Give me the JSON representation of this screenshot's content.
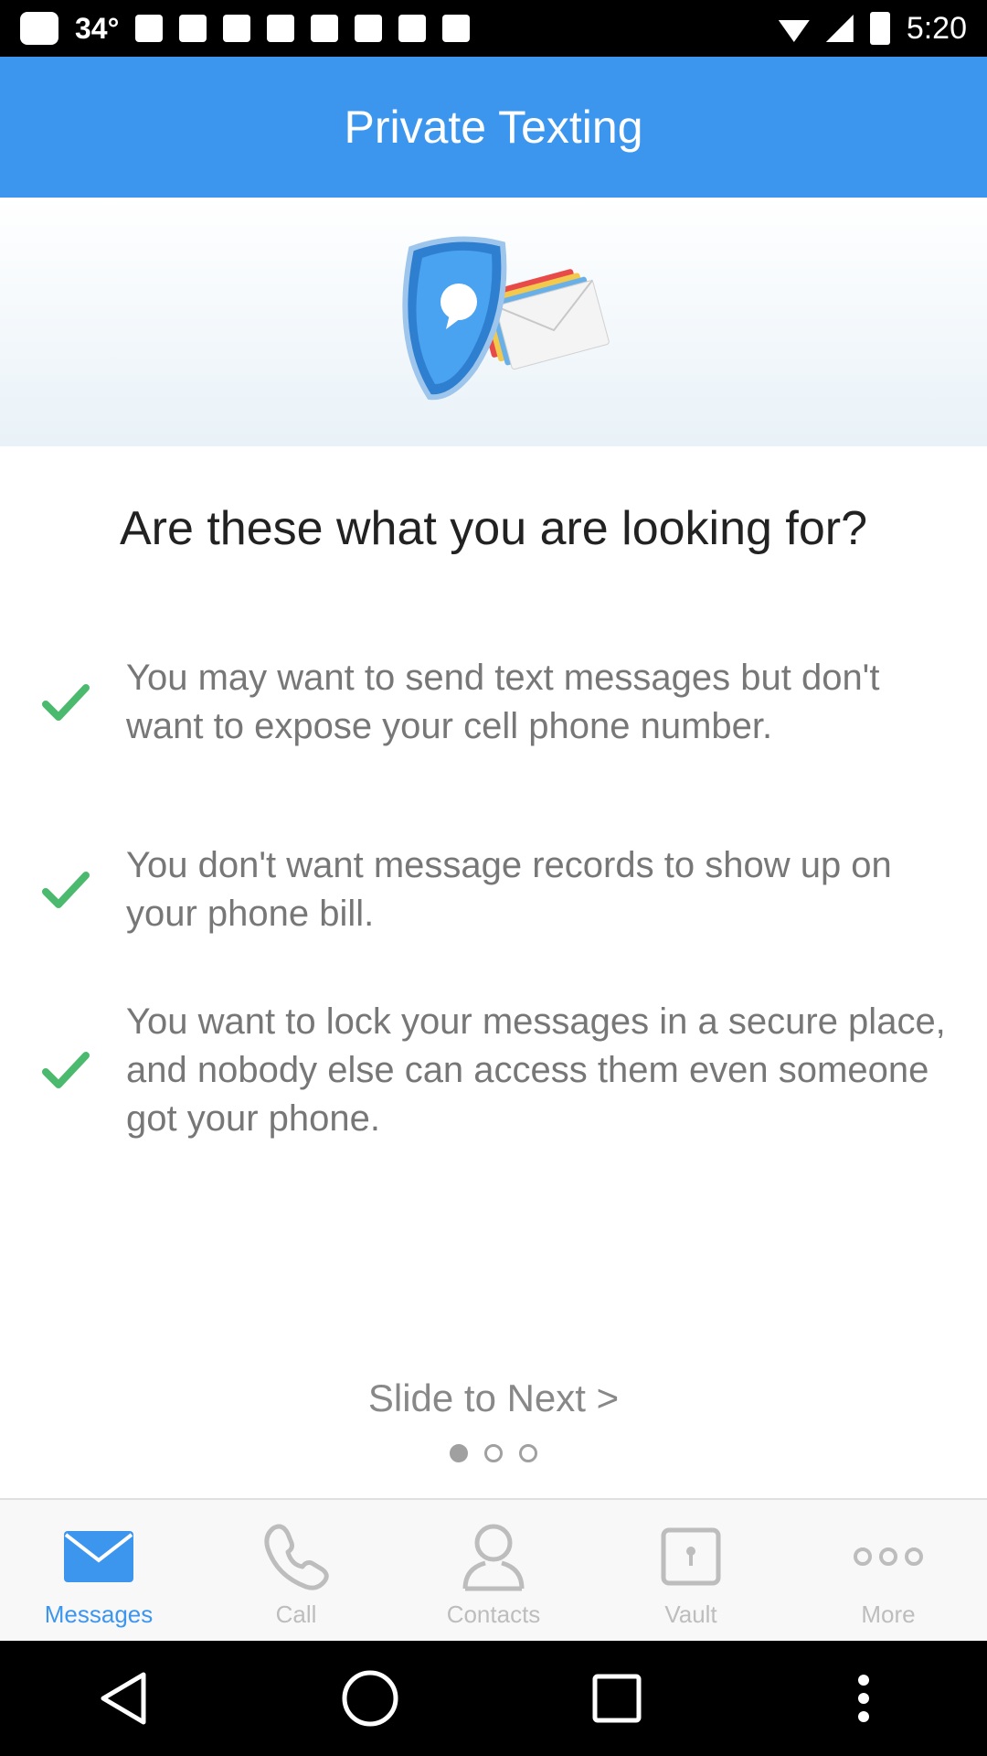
{
  "status_bar": {
    "temperature": "34°",
    "time": "5:20"
  },
  "header": {
    "title": "Private Texting"
  },
  "main": {
    "question": "Are these what you are looking for?",
    "items": [
      {
        "text": "You may want to send text messages but don't want to expose your cell phone number."
      },
      {
        "text": "You don't want message records to show up on your phone bill."
      },
      {
        "text": "You want to lock your messages in a secure place, and nobody else can access them even someone got your phone."
      }
    ],
    "slide_hint": "Slide to Next >",
    "page_indicator": {
      "current": 1,
      "total": 3
    }
  },
  "bottom_nav": {
    "items": [
      {
        "label": "Messages",
        "icon": "envelope-icon",
        "active": true
      },
      {
        "label": "Call",
        "icon": "phone-icon",
        "active": false
      },
      {
        "label": "Contacts",
        "icon": "person-icon",
        "active": false
      },
      {
        "label": "Vault",
        "icon": "lock-icon",
        "active": false
      },
      {
        "label": "More",
        "icon": "more-icon",
        "active": false
      }
    ]
  },
  "colors": {
    "primary": "#3d96ee",
    "check": "#4cba6e",
    "inactive": "#bdbdbd"
  }
}
